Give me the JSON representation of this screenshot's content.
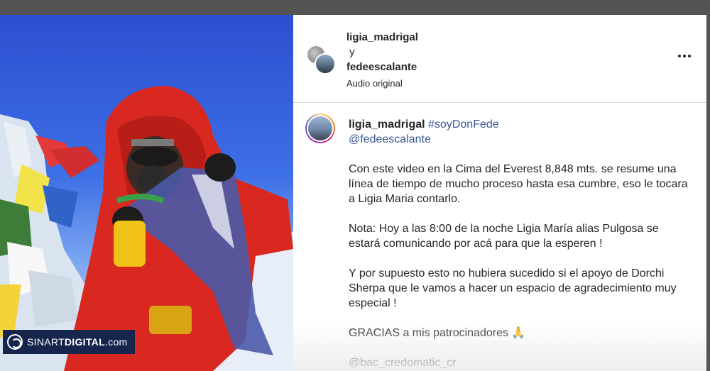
{
  "header": {
    "user1": "ligia_madrigal",
    "conjunction": "y",
    "user2": "fedeescalante",
    "audio": "Audio original"
  },
  "caption": {
    "username": "ligia_madrigal",
    "hashtag": "#soyDonFede",
    "mention": "@fedeescalante",
    "paragraphs": [
      "Con este video en la Cima del Everest 8,848 mts. se resume una línea de tiempo de mucho proceso hasta esa cumbre, eso le tocara a Ligia Maria contarlo.",
      "Nota: Hoy a las 8:00 de la noche Ligia María alias Pulgosa se estará comunicando por acá para que la esperen !",
      "Y por supuesto esto no hubiera sucedido si el apoyo de Dorchi Sherpa que le vamos a hacer un espacio de agradecimiento muy especial !",
      "GRACIAS a mis patrocinadores 🙏",
      "@bac_credomatic_cr"
    ]
  },
  "watermark": {
    "brand": "SINART",
    "brand_bold": "DIGITAL",
    "suffix": ".com"
  },
  "colors": {
    "tag": "#385898",
    "text": "#262626",
    "backdrop": "#545454"
  }
}
